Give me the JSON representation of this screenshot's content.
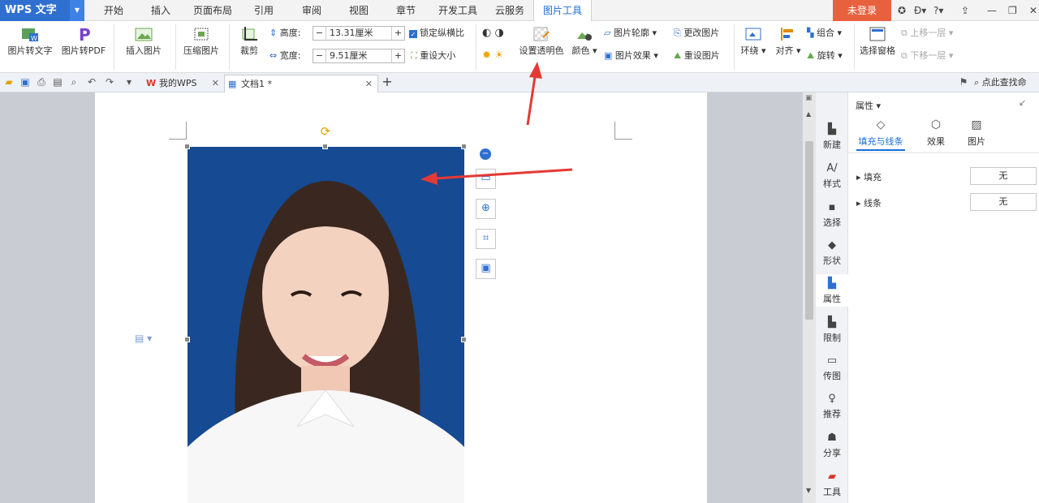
{
  "app": {
    "logo": "WPS 文字",
    "login_label": "未登录"
  },
  "menu_tabs": [
    {
      "label": "开始"
    },
    {
      "label": "插入"
    },
    {
      "label": "页面布局"
    },
    {
      "label": "引用"
    },
    {
      "label": "审阅"
    },
    {
      "label": "视图"
    },
    {
      "label": "章节"
    },
    {
      "label": "开发工具"
    },
    {
      "label": "云服务"
    },
    {
      "label": "图片工具"
    }
  ],
  "ribbon": {
    "pic_to_text": "图片转文字",
    "pic_to_pdf": "图片转PDF",
    "insert_picture": "插入图片",
    "compress": "压缩图片",
    "crop": "裁剪",
    "height_label": "高度:",
    "height_value": "13.31厘米",
    "width_label": "宽度:",
    "width_value": "9.51厘米",
    "lock_ratio": "锁定纵横比",
    "reset_size": "重设大小",
    "set_transparent": "设置透明色",
    "color": "颜色",
    "outline": "图片轮廓",
    "effects": "图片效果",
    "change_picture": "更改图片",
    "reset_picture": "重设图片",
    "wrap": "环绕",
    "align": "对齐",
    "group": "组合",
    "rotate": "旋转",
    "selection_pane": "选择窗格",
    "bring_forward": "上移一层",
    "send_backward": "下移一层"
  },
  "quickbar": {
    "tab_mywps": "我的WPS",
    "tab_doc": "文档1 *",
    "search_hint": "点此查找命"
  },
  "sidenav": [
    {
      "label": "新建"
    },
    {
      "label": "样式"
    },
    {
      "label": "选择"
    },
    {
      "label": "形状"
    },
    {
      "label": "属性"
    },
    {
      "label": "限制"
    },
    {
      "label": "传图"
    },
    {
      "label": "推荐"
    },
    {
      "label": "分享"
    },
    {
      "label": "工具"
    }
  ],
  "panel": {
    "title": "属性",
    "tabs": [
      {
        "label": "填充与线条"
      },
      {
        "label": "效果"
      },
      {
        "label": "图片"
      }
    ],
    "fill_label": "填充",
    "fill_value": "无",
    "line_label": "线条",
    "line_value": "无"
  },
  "colors": {
    "accent": "#1a6ed8",
    "photo_bg": "#164a93",
    "login_bg": "#e8613e",
    "arrow": "#e53935"
  }
}
